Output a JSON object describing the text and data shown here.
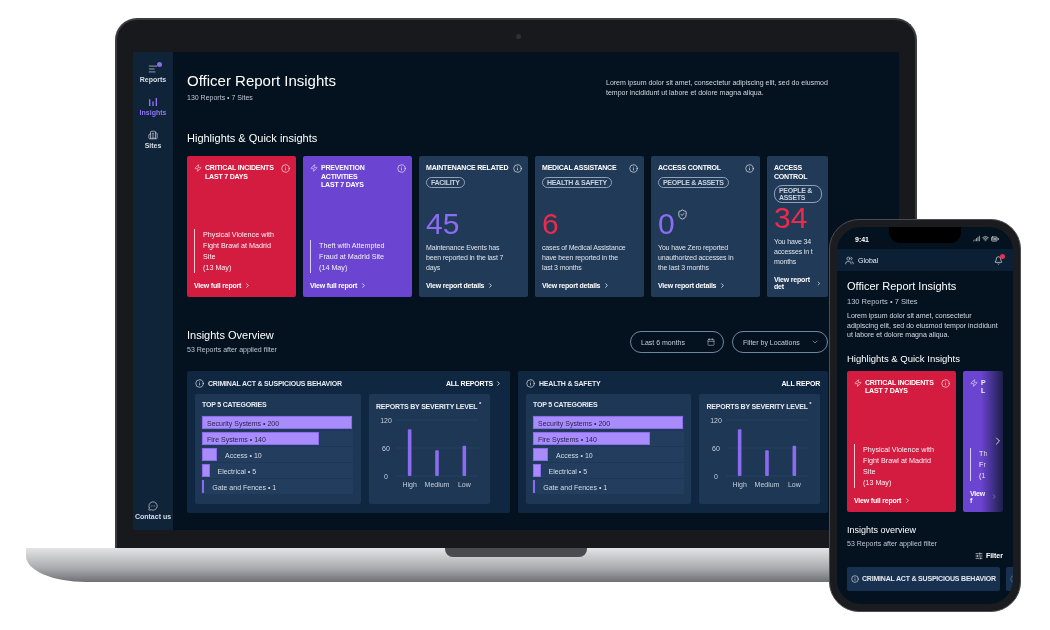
{
  "laptop": {
    "sidebar": {
      "items": [
        {
          "label": "Reports",
          "selected": false,
          "notification": true
        },
        {
          "label": "Insights",
          "selected": true,
          "notification": false
        },
        {
          "label": "Sites",
          "selected": false,
          "notification": false
        }
      ],
      "footer": "Contact us"
    },
    "header": {
      "title": "Officer Report Insights",
      "subtitle": "130 Reports • 7 Sites",
      "description": "Lorem ipsum dolor sit amet, consectetur adipiscing elit, sed do eiusmod tempor incididunt ut labore et dolore magna aliqua."
    },
    "highlights": {
      "title": "Highlights & Quick insights",
      "cards": [
        {
          "kind": "incident",
          "color": "#d31c40",
          "title": "CRITICAL INCIDENTS",
          "period": "LAST 7 DAYS",
          "info": true,
          "lines": [
            "Physical Violence with",
            "Fight Brawl at Madrid",
            "Site"
          ],
          "date": "(13 May)",
          "link": "View full report"
        },
        {
          "kind": "incident",
          "color": "#6b44d1",
          "title": "PREVENTION ACTIVITIES",
          "period": "LAST 7 DAYS",
          "info": true,
          "lines": [
            "Theft with Attempted",
            "Fraud at Madrid Site"
          ],
          "date": "(14 May)",
          "link": "View full report"
        },
        {
          "kind": "metric",
          "color": "#8c6cf2",
          "title": "MAINTENANCE RELATED",
          "tag": "FACILITY",
          "info": true,
          "value": "45",
          "badge_icon": false,
          "lines": [
            "Maintenance Events has",
            "been reported in the last 7",
            "days"
          ],
          "link": "View report details"
        },
        {
          "kind": "metric",
          "color": "#ec2a4c",
          "title": "MEDICAL ASSISTANCE",
          "tag": "HEALTH & SAFETY",
          "info": true,
          "value": "6",
          "badge_icon": false,
          "lines": [
            "cases of Medical Assistance",
            "have been reported in the",
            "last 3 months"
          ],
          "link": "View report details"
        },
        {
          "kind": "metric",
          "color": "#8c6cf2",
          "title": "ACCESS CONTROL",
          "tag": "PEOPLE & ASSETS",
          "info": true,
          "value": "0",
          "badge_icon": true,
          "lines": [
            "You have Zero reported",
            "unauthorized accesses in",
            "the last 3 months"
          ],
          "link": "View report details"
        },
        {
          "kind": "metric",
          "color": "#ec2a4c",
          "title": "ACCESS CONTROL",
          "tag": "PEOPLE & ASSETS",
          "info": false,
          "value": "34",
          "badge_icon": false,
          "lines": [
            "You have 34",
            "accesses in t",
            "months"
          ],
          "link": "View report det"
        }
      ]
    },
    "overview": {
      "title": "Insights Overview",
      "subtitle": "53 Reports after applied filter",
      "filters": [
        {
          "kind": "date",
          "label": "Last 6 months"
        },
        {
          "kind": "select",
          "label": "Filter by Locations"
        }
      ],
      "panels": [
        {
          "title": "CRIMINAL ACT & SUSPICIOUS BEHAVIOR",
          "link": "ALL REPORTS",
          "link_arrow": true,
          "categories": {
            "title": "TOP 5 CATEGORIES",
            "items": [
              {
                "label": "Security Systems • 200",
                "level": 1
              },
              {
                "label": "Fire Systems • 140",
                "level": 0.78
              },
              {
                "label": "Access • 10",
                "level": 0.1
              },
              {
                "label": "Electrical • 5",
                "level": 0.05
              },
              {
                "label": "Gate and Fences • 1",
                "level": 0.015
              }
            ]
          },
          "severity": {
            "title": "REPORTS BY SEVERITY LEVEL $^{*}$",
            "chart_data": {
              "type": "bar",
              "categories": [
                "High",
                "Medium",
                "Low"
              ],
              "values": [
                100,
                55,
                65
              ],
              "ylim": [
                0,
                120
              ],
              "yticks": [
                0,
                60,
                120
              ]
            }
          }
        },
        {
          "title": "HEALTH & SAFETY",
          "link": "ALL REPOR",
          "link_arrow": false,
          "categories": {
            "title": "TOP 5 CATEGORIES",
            "items": [
              {
                "label": "Security Systems • 200",
                "level": 1
              },
              {
                "label": "Fire Systems • 140",
                "level": 0.78
              },
              {
                "label": "Access • 10",
                "level": 0.1
              },
              {
                "label": "Electrical • 5",
                "level": 0.05
              },
              {
                "label": "Gate and Fences • 1",
                "level": 0.015
              }
            ]
          },
          "severity": {
            "title": "REPORTS BY SEVERITY LEVEL $^{*}$",
            "chart_data": {
              "type": "bar",
              "categories": [
                "High",
                "Medium",
                "Low"
              ],
              "values": [
                100,
                55,
                65
              ],
              "ylim": [
                0,
                120
              ],
              "yticks": [
                0,
                60,
                120
              ]
            }
          }
        }
      ]
    }
  },
  "phone": {
    "time": "9:41",
    "topbar": {
      "location": "Global",
      "notification": true
    },
    "header": {
      "title": "Officer Report Insights",
      "subtitle": "130 Reports • 7 Sites",
      "description": "Lorem ipsum dolor sit amet, consectetur adipiscing elit, sed do eiusmod tempor incididunt ut labore et dolore magna aliqua."
    },
    "highlights": {
      "title": "Highlights & Quick Insights",
      "cards": [
        {
          "kind": "incident",
          "color": "#d31c40",
          "title": "CRITICAL INCIDENTS",
          "period": "LAST 7 DAYS",
          "info": true,
          "lines": [
            "Physical Violence with",
            "Fight Brawl at Madrid",
            "Site"
          ],
          "date": "(13 May)",
          "link": "View full report"
        },
        {
          "kind": "incident",
          "color": "#6b44d1",
          "title": "P",
          "period": "L",
          "info": false,
          "lines": [
            "Th",
            "Fr"
          ],
          "date": "(1",
          "link": "View f"
        }
      ]
    },
    "overview": {
      "title": "Insights overview",
      "subtitle": "53 Reports after applied filter",
      "filter": "Filter",
      "panels": [
        {
          "title": "CRIMINAL ACT & SUSPICIOUS BEHAVIOR"
        }
      ]
    }
  }
}
